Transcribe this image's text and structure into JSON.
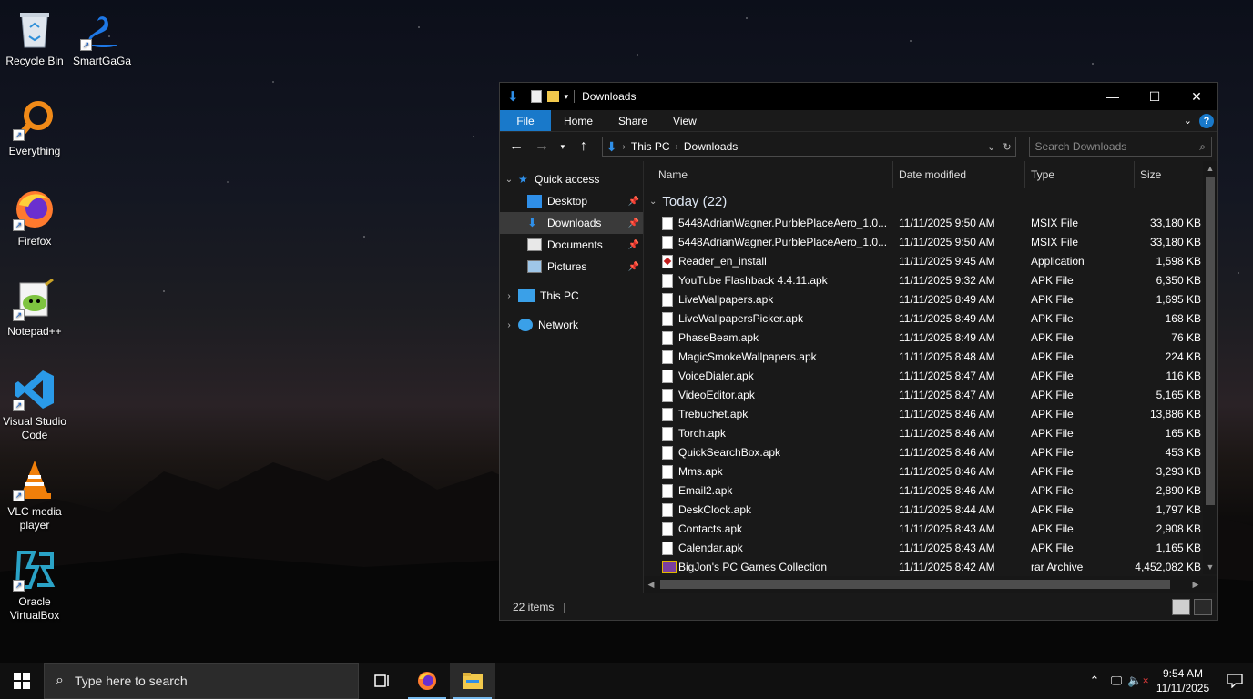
{
  "desktop": {
    "icons": [
      {
        "label": "Recycle Bin",
        "icon": "recycle-bin-icon"
      },
      {
        "label": "SmartGaGa",
        "icon": "smartgaga-icon"
      },
      {
        "label": "Everything",
        "icon": "everything-icon"
      },
      {
        "label": "Firefox",
        "icon": "firefox-icon"
      },
      {
        "label": "Notepad++",
        "icon": "notepadpp-icon"
      },
      {
        "label": "Visual Studio Code",
        "icon": "vscode-icon"
      },
      {
        "label": "VLC media player",
        "icon": "vlc-icon"
      },
      {
        "label": "Oracle VirtualBox",
        "icon": "virtualbox-icon"
      }
    ]
  },
  "explorer": {
    "title": "Downloads",
    "ribbon_tabs": [
      "File",
      "Home",
      "Share",
      "View"
    ],
    "address": {
      "crumbs": [
        "This PC",
        "Downloads"
      ]
    },
    "search_placeholder": "Search Downloads",
    "nav": {
      "quick_access": "Quick access",
      "pinned": [
        "Desktop",
        "Downloads",
        "Documents",
        "Pictures"
      ],
      "this_pc": "This PC",
      "network": "Network"
    },
    "columns": {
      "name": "Name",
      "date": "Date modified",
      "type": "Type",
      "size": "Size"
    },
    "group_label": "Today (22)",
    "files": [
      {
        "name": "5448AdrianWagner.PurblePlaceAero_1.0....",
        "date": "11/11/2025 9:50 AM",
        "type": "MSIX File",
        "size": "33,180 KB",
        "icon": "doc"
      },
      {
        "name": "5448AdrianWagner.PurblePlaceAero_1.0....",
        "date": "11/11/2025 9:50 AM",
        "type": "MSIX File",
        "size": "33,180 KB",
        "icon": "doc"
      },
      {
        "name": "Reader_en_install",
        "date": "11/11/2025 9:45 AM",
        "type": "Application",
        "size": "1,598 KB",
        "icon": "pdf"
      },
      {
        "name": "YouTube Flashback 4.4.11.apk",
        "date": "11/11/2025 9:32 AM",
        "type": "APK File",
        "size": "6,350 KB",
        "icon": "doc"
      },
      {
        "name": "LiveWallpapers.apk",
        "date": "11/11/2025 8:49 AM",
        "type": "APK File",
        "size": "1,695 KB",
        "icon": "doc"
      },
      {
        "name": "LiveWallpapersPicker.apk",
        "date": "11/11/2025 8:49 AM",
        "type": "APK File",
        "size": "168 KB",
        "icon": "doc"
      },
      {
        "name": "PhaseBeam.apk",
        "date": "11/11/2025 8:49 AM",
        "type": "APK File",
        "size": "76 KB",
        "icon": "doc"
      },
      {
        "name": "MagicSmokeWallpapers.apk",
        "date": "11/11/2025 8:48 AM",
        "type": "APK File",
        "size": "224 KB",
        "icon": "doc"
      },
      {
        "name": "VoiceDialer.apk",
        "date": "11/11/2025 8:47 AM",
        "type": "APK File",
        "size": "116 KB",
        "icon": "doc"
      },
      {
        "name": "VideoEditor.apk",
        "date": "11/11/2025 8:47 AM",
        "type": "APK File",
        "size": "5,165 KB",
        "icon": "doc"
      },
      {
        "name": "Trebuchet.apk",
        "date": "11/11/2025 8:46 AM",
        "type": "APK File",
        "size": "13,886 KB",
        "icon": "doc"
      },
      {
        "name": "Torch.apk",
        "date": "11/11/2025 8:46 AM",
        "type": "APK File",
        "size": "165 KB",
        "icon": "doc"
      },
      {
        "name": "QuickSearchBox.apk",
        "date": "11/11/2025 8:46 AM",
        "type": "APK File",
        "size": "453 KB",
        "icon": "doc"
      },
      {
        "name": "Mms.apk",
        "date": "11/11/2025 8:46 AM",
        "type": "APK File",
        "size": "3,293 KB",
        "icon": "doc"
      },
      {
        "name": "Email2.apk",
        "date": "11/11/2025 8:46 AM",
        "type": "APK File",
        "size": "2,890 KB",
        "icon": "doc"
      },
      {
        "name": "DeskClock.apk",
        "date": "11/11/2025 8:44 AM",
        "type": "APK File",
        "size": "1,797 KB",
        "icon": "doc"
      },
      {
        "name": "Contacts.apk",
        "date": "11/11/2025 8:43 AM",
        "type": "APK File",
        "size": "2,908 KB",
        "icon": "doc"
      },
      {
        "name": "Calendar.apk",
        "date": "11/11/2025 8:43 AM",
        "type": "APK File",
        "size": "1,165 KB",
        "icon": "doc"
      },
      {
        "name": "BigJon's PC Games Collection",
        "date": "11/11/2025 8:42 AM",
        "type": "rar Archive",
        "size": "4,452,082 KB",
        "icon": "rar"
      }
    ],
    "status": "22 items"
  },
  "taskbar": {
    "search_placeholder": "Type here to search",
    "time": "9:54 AM",
    "date": "11/11/2025"
  },
  "colors": {
    "accent": "#1979ca",
    "taskbar": "#101010",
    "window_bg": "#191919"
  }
}
